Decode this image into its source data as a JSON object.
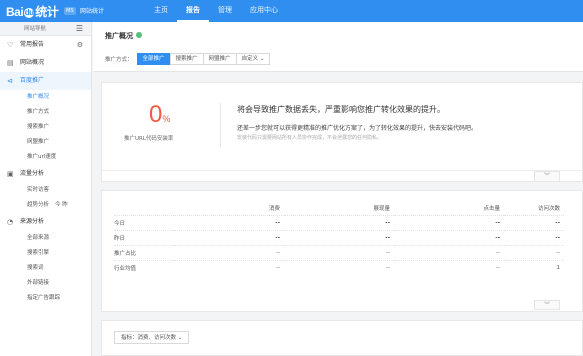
{
  "topbar": {
    "logo_left": "Bai",
    "logo_paw": "du",
    "logo_right": "统计",
    "tag": "MS",
    "app_name": "网站统计",
    "nav": [
      "主页",
      "报告",
      "管理",
      "应用中心"
    ],
    "active_nav": 1
  },
  "sidebar": {
    "header": "网站导航",
    "toggle_icon": "menu-toggle-icon",
    "groups": [
      {
        "label": "常用报告",
        "icon": "heart-icon",
        "has_gear": true,
        "open": false,
        "items": []
      },
      {
        "label": "网站概况",
        "icon": "overview-icon",
        "open": false,
        "items": []
      },
      {
        "label": "百度推广",
        "icon": "megaphone-icon",
        "open": true,
        "items": [
          "推广概况",
          "推广方式",
          "搜索推广",
          "网盟推广",
          "推广url速度"
        ],
        "selected": 0
      },
      {
        "label": "流量分析",
        "icon": "traffic-icon",
        "open": false,
        "items": [
          "实时访客",
          "趋势分析"
        ],
        "extra": {
          "index": 1,
          "text": "今  昨"
        }
      },
      {
        "label": "来源分析",
        "icon": "source-icon",
        "open": false,
        "items": [
          "全部来源",
          "搜索引擎",
          "搜索词",
          "外部链接",
          "指定广告跟踪"
        ]
      }
    ]
  },
  "main": {
    "title": "推广概况",
    "mode_label": "推广方式：",
    "modes": [
      "全部推广",
      "搜索推广",
      "网盟推广",
      "自定义"
    ],
    "active_mode": 0,
    "dropdown_arrow": "⌄"
  },
  "notice": {
    "percent": "0",
    "percent_sign": "%",
    "percent_label": "推广URL代码安装率",
    "headline": "将会导致推广数据丢失，严重影响您推广转化效果的提升。",
    "line2": "还差一步您就可以获得更精准的推广优化方案了，为了转化效果的提升，快去安装代码吧。",
    "line3": "安装代码只需要网站所有人员协作完成，不会泄露您的任何隐私。",
    "collapse_glyph": "︾"
  },
  "stats": {
    "columns": [
      "",
      "消费",
      "展现量",
      "点击量",
      "访问次数"
    ],
    "rows": [
      {
        "label": "今日",
        "values": [
          "--",
          "--",
          "--",
          "--"
        ],
        "bold": true
      },
      {
        "label": "昨日",
        "values": [
          "--",
          "--",
          "--",
          "--"
        ],
        "bold": true
      },
      {
        "label": "推广占比",
        "values": [
          "--",
          "--",
          "--",
          "--"
        ],
        "bold": false
      },
      {
        "label": "行业均值",
        "values": [
          "--",
          "--",
          "--",
          "1"
        ],
        "bold": false
      }
    ],
    "collapse_glyph": "︾"
  },
  "metric": {
    "label": "指标：消费、访问次数",
    "arrow": "⌄"
  }
}
